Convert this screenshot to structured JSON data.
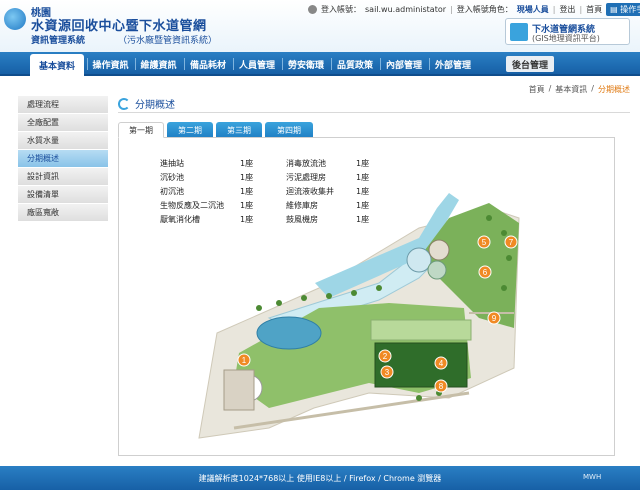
{
  "header": {
    "city": "桃園",
    "title": "水資源回收中心暨下水道管網",
    "subtitle": "資訊管理系統",
    "subtitle_paren": "（污水廠暨管資訊系統）",
    "login_label": "登入帳號：",
    "login_account": "sail.wu.administator",
    "role_label": "登入帳號角色：",
    "role_value": "現場人員",
    "logout": "登出",
    "home": "首頁",
    "manual": "操作手冊",
    "gis_title": "下水道管網系統",
    "gis_subtitle": "(GIS地理資訊平台)"
  },
  "nav": {
    "items": [
      "基本資料",
      "操作資訊",
      "維護資訊",
      "備品耗材",
      "人員管理",
      "勞安衛環",
      "品質政策",
      "內部管理",
      "外部管理"
    ],
    "backend": "後台管理"
  },
  "breadcrumb": [
    "首頁",
    "/",
    "基本資訊",
    "/",
    "分期概述"
  ],
  "sidebar": {
    "items": [
      "處理流程",
      "全廠配置",
      "水質水量",
      "分期概述",
      "設計資訊",
      "設備清單",
      "廠區寬敞"
    ]
  },
  "section_title": "分期概述",
  "tabs": [
    "第一期",
    "第二期",
    "第三期",
    "第四期"
  ],
  "facilities": [
    [
      "進抽站",
      "1座",
      "消毒放流池",
      "1座"
    ],
    [
      "沉砂池",
      "1座",
      "污泥處理房",
      "1座"
    ],
    [
      "初沉池",
      "1座",
      "迴流液收集井",
      "1座"
    ],
    [
      "生物反應及二沉池",
      "1座",
      "維修庫房",
      "1座"
    ],
    [
      "厭氧消化槽",
      "1座",
      "鼓風機房",
      "1座"
    ]
  ],
  "map_markers": [
    "1",
    "2",
    "3",
    "4",
    "5",
    "6",
    "7",
    "8",
    "9"
  ],
  "footer": {
    "text": "建議解析度1024*768以上 使用IE8以上 / Firefox / Chrome 瀏覽器",
    "brand": "MWH"
  },
  "colors": {
    "brand_blue": "#1a4e9c",
    "nav_blue": "#1f6fb5",
    "accent_orange": "#e07b14",
    "marker_orange": "#f08a24"
  }
}
